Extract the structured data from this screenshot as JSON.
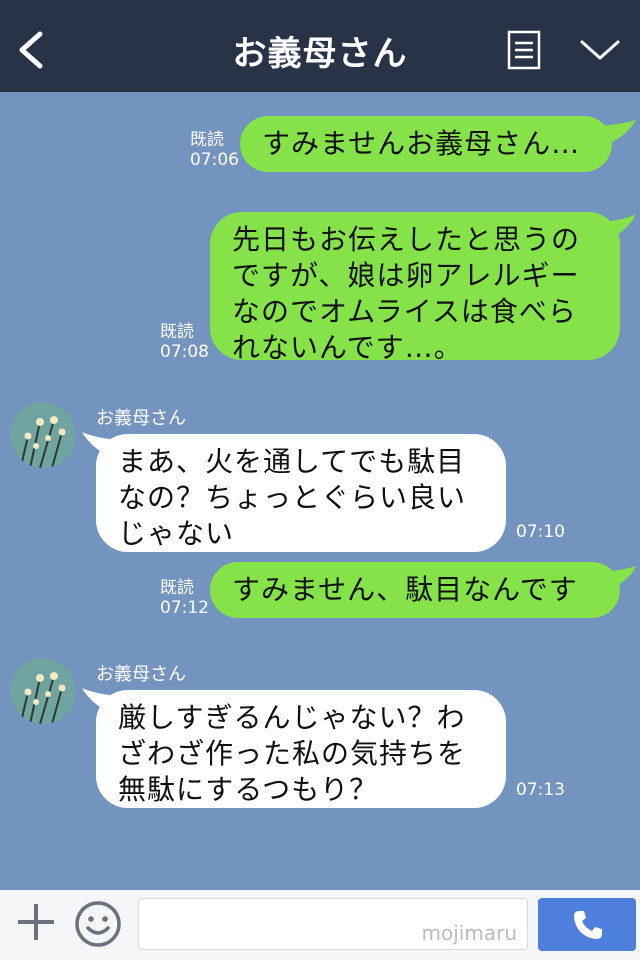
{
  "header": {
    "title": "お義母さん",
    "back_icon": "chevron-left-icon",
    "menu_icon": "list-icon",
    "down_icon": "chevron-down-icon"
  },
  "messages": [
    {
      "from": "me",
      "read": "既読",
      "time": "07:06",
      "lines": [
        "すみませんお義母さん…"
      ]
    },
    {
      "from": "me",
      "read": "既読",
      "time": "07:08",
      "lines": [
        "先日もお伝えしたと思うの",
        "ですが、娘は卵アレルギー",
        "なのでオムライスは食べら",
        "れないんです…。"
      ]
    },
    {
      "from": "other",
      "sender": "お義母さん",
      "time": "07:10",
      "lines": [
        "まあ、火を通してでも駄目",
        "なの？ちょっとぐらい良い",
        "じゃない"
      ]
    },
    {
      "from": "me",
      "read": "既読",
      "time": "07:12",
      "lines": [
        "すみません、駄目なんです"
      ]
    },
    {
      "from": "other",
      "sender": "お義母さん",
      "time": "07:13",
      "lines": [
        "厳しすぎるんじゃない？わ",
        "ざわざ作った私の気持ちを",
        "無駄にするつもり？"
      ]
    }
  ],
  "footer": {
    "plus_icon": "plus-icon",
    "emoji_icon": "smiley-icon",
    "watermark": "mojimaru",
    "call_icon": "phone-icon"
  },
  "colors": {
    "header_bg": "#283348",
    "chat_bg": "#7494c0",
    "my_bubble": "#85e249",
    "their_bubble": "#ffffff",
    "call_button": "#4f7fdc"
  }
}
